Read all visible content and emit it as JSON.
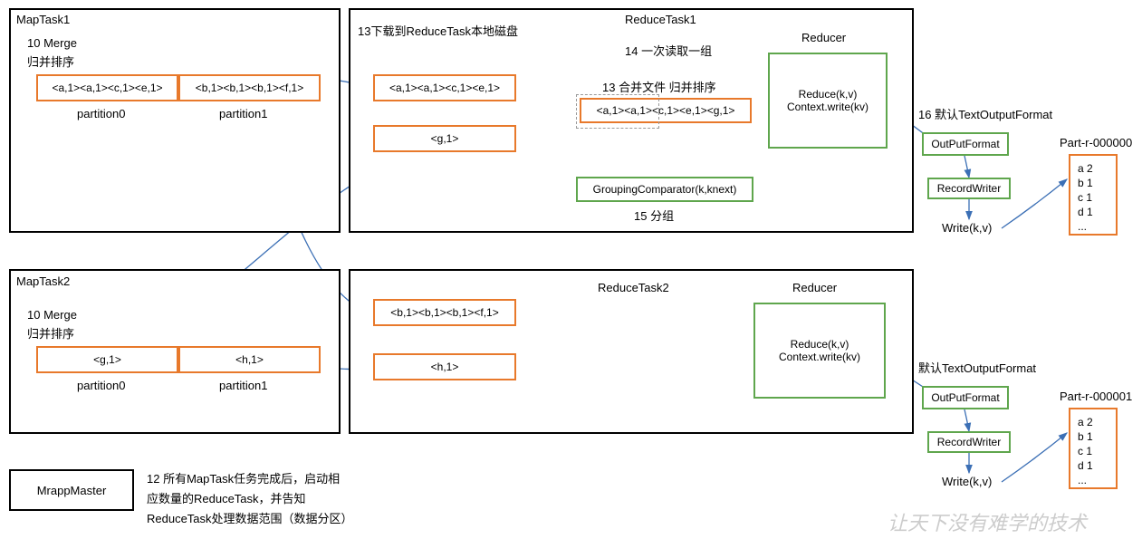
{
  "maptask1": {
    "title": "MapTask1",
    "merge": "10 Merge",
    "merge2": "归并排序",
    "p0": "<a,1><a,1><c,1><e,1>",
    "p1": "<b,1><b,1><b,1><f,1>",
    "p0label": "partition0",
    "p1label": "partition1"
  },
  "maptask2": {
    "title": "MapTask2",
    "merge": "10 Merge",
    "merge2": "归并排序",
    "p0": "<g,1>",
    "p1": "<h,1>",
    "p0label": "partition0",
    "p1label": "partition1"
  },
  "reducetask1": {
    "title": "ReduceTask1",
    "download": "13下载到ReduceTask本地磁盘",
    "readgroup": "14 一次读取一组",
    "mergefiles": "13 合并文件 归并排序",
    "file1": "<a,1><a,1><c,1><e,1>",
    "file2": "<g,1>",
    "merged": "<a,1><a,1><c,1><e,1><g,1>",
    "grouping": "GroupingComparator(k,knext)",
    "grouplabel": "15 分组",
    "reducer": "Reducer",
    "reduce1": "Reduce(k,v)",
    "reduce2": "Context.write(kv)"
  },
  "reducetask2": {
    "title": "ReduceTask2",
    "file1": "<b,1><b,1><b,1><f,1>",
    "file2": "<h,1>",
    "reducer": "Reducer",
    "reduce1": "Reduce(k,v)",
    "reduce2": "Context.write(kv)"
  },
  "output1": {
    "defaultformat": "16 默认TextOutputFormat",
    "outputformat": "OutPutFormat",
    "recordwriter": "RecordWriter",
    "write": "Write(k,v)",
    "filename": "Part-r-000000",
    "content": "a 2\nb 1\nc 1\nd 1\n..."
  },
  "output2": {
    "defaultformat": "默认TextOutputFormat",
    "outputformat": "OutPutFormat",
    "recordwriter": "RecordWriter",
    "write": "Write(k,v)",
    "filename": "Part-r-000001",
    "content": "a 2\nb 1\nc 1\nd 1\n..."
  },
  "master": {
    "title": "MrappMaster",
    "note1": "12 所有MapTask任务完成后，启动相",
    "note2": "应数量的ReduceTask，并告知",
    "note3": "ReduceTask处理数据范围（数据分区）"
  },
  "watermark": "让天下没有难学的技术"
}
